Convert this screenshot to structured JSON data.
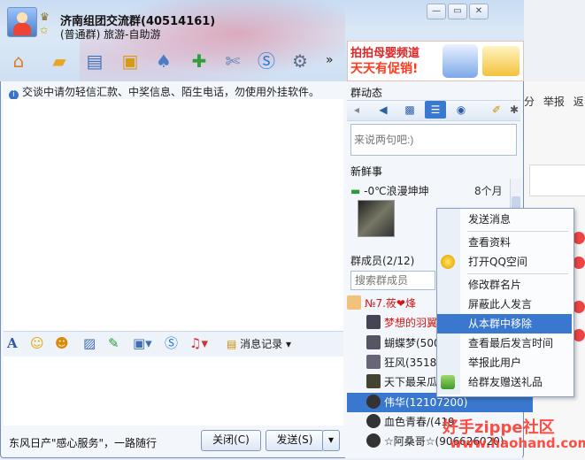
{
  "background_page": {
    "links": [
      "分",
      "举报",
      "返"
    ]
  },
  "window": {
    "group_name": "济南组团交流群(40514161)",
    "group_subtitle": "(普通群) 旅游-自助游",
    "controls": [
      "minimize",
      "maximize",
      "close"
    ]
  },
  "toolbar": {
    "icons": [
      "home-icon",
      "folder-icon",
      "album-icon",
      "board-icon",
      "card-icon",
      "add-icon",
      "tools-icon",
      "search-s-icon",
      "settings-icon"
    ],
    "more_label": "»"
  },
  "ad": {
    "line1": "拍拍母婴频道",
    "line2": "天天有促销!"
  },
  "notice": {
    "text": "交谈中请勿轻信汇款、中奖信息、陌生电话，勿使用外挂软件。"
  },
  "input_toolbar": {
    "font_label": "A",
    "message_record_label": "消息记录"
  },
  "bottom": {
    "ad_text": "东风日产\"感心服务\"，一路随行",
    "close_label": "关闭(C)",
    "send_label": "发送(S)"
  },
  "right_panel": {
    "dynamics_title": "群动态",
    "speak_placeholder": "来说两句吧:)",
    "news_title": "新鲜事",
    "news_item": {
      "name": "-0℃浪漫坤坤",
      "time": "8个月"
    },
    "members_title": "群成员(2/12)",
    "search_placeholder": "搜索群成员",
    "members": [
      "№7.莜❤烽",
      "梦想的羽翼",
      "蝴蝶梦(5007",
      "狂风(35184",
      "天下最呆瓜",
      "伟华(12107200)",
      "血色青春/(419",
      "☆阿桑哥☆(906626020)"
    ],
    "selected_member_index": 5
  },
  "context_menu": {
    "items": [
      "发送消息",
      "查看资料",
      "打开QQ空间",
      "修改群名片",
      "屏蔽此人发言",
      "从本群中移除",
      "查看最后发言时间",
      "举报此用户",
      "给群友赠送礼品"
    ],
    "highlighted_index": 5
  },
  "watermark": {
    "line1": "好手zippe社区",
    "line2": "www.haohand.com"
  },
  "colors": {
    "accent": "#3a78cf",
    "title_bg": "#cfe0f3",
    "ad_red": "#e02424"
  }
}
